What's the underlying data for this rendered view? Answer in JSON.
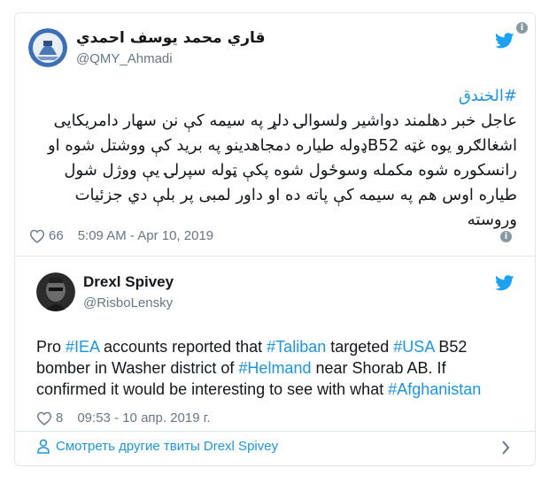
{
  "tweet": {
    "display_name": "قاري محمد یوسف احمدي",
    "handle": "@QMY_Ahmadi",
    "hashtag": "#الخندق",
    "text_lines": [
      "عاجل خبر دهلمند دواشیر ولسوالۍ دلړ په سیمه کې نن سهار دامریکایی",
      "اشغالګرو یوه غټه B52ډوله طیاره دمجاهدینو په برید کې ووشتل شوه او",
      "رانسکوره شوه مکمله وسوځول شوه پکې ټوله سپرلۍ یې ووژل شول",
      "طیاره اوس هم په سیمه کې پاته ده او داور لمبی پر بلې دي جزئیات",
      "وروسته"
    ],
    "likes": "66",
    "timestamp": "5:09 AM - Apr 10, 2019",
    "info_symbol": "i"
  },
  "quoted": {
    "display_name": "Drexl Spivey",
    "handle": "@RisboLensky",
    "text_segments": [
      {
        "t": "Pro ",
        "tag": false
      },
      {
        "t": "#IEA",
        "tag": true
      },
      {
        "t": " accounts reported that ",
        "tag": false
      },
      {
        "t": "#Taliban",
        "tag": true
      },
      {
        "t": " targeted ",
        "tag": false
      },
      {
        "t": "#USA",
        "tag": true
      },
      {
        "t": " B52 bomber in Washer district of ",
        "tag": false
      },
      {
        "t": "#Helmand",
        "tag": true
      },
      {
        "t": " near Shorab AB. If confirmed it would be interesting to see with what ",
        "tag": false
      },
      {
        "t": "#Afghanistan",
        "tag": true
      }
    ],
    "likes": "8",
    "timestamp": "09:53 - 10 апр. 2019 г."
  },
  "more_tweets_label": "Смотреть другие твиты Drexl Spivey",
  "colors": {
    "link": "#1b95e0",
    "muted": "#657786",
    "border": "#e1e8ed",
    "twitter_blue": "#1da1f2"
  },
  "icons": [
    "twitter-bird-icon",
    "info-icon",
    "heart-icon",
    "person-icon",
    "chevron-right-icon"
  ]
}
